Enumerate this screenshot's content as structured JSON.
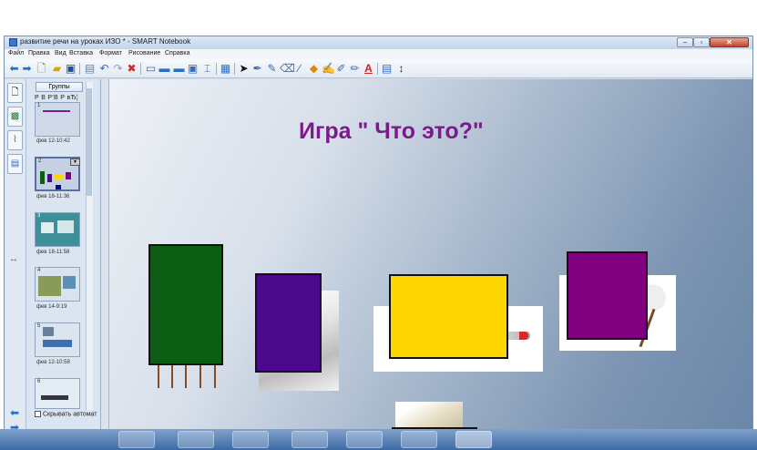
{
  "window": {
    "title": "развитие речи на уроках ИЗО * - SMART Notebook",
    "minimize_glyph": "–",
    "maximize_glyph": "▫",
    "close_glyph": "✕"
  },
  "menu": [
    "Файл",
    "Правка",
    "Вид",
    "Вставка",
    "Формат",
    "Рисование",
    "Справка"
  ],
  "toolbar_icons": [
    "back-arrow-icon",
    "forward-arrow-icon",
    "blank-page-icon",
    "open-folder-icon",
    "save-icon",
    "paste-icon",
    "undo-icon",
    "redo-icon",
    "delete-icon",
    "screen-shade-icon",
    "full-screen-icon",
    "dual-display-icon",
    "capture-icon",
    "document-camera-icon",
    "table-icon",
    "select-icon",
    "pen-icon",
    "creative-pen-icon",
    "eraser-icon",
    "line-icon",
    "shape-icon",
    "fill-icon",
    "magic-pen-icon",
    "shape-recognition-pen-icon",
    "text-icon",
    "properties-icon",
    "more-icon"
  ],
  "sorter": {
    "groups_button": "Группы",
    "group_tag": "Р В Р'В Р вЂ¦",
    "thumbnails": [
      {
        "num": "1",
        "date": "фев 12-10:42"
      },
      {
        "num": "2",
        "date": "фев 18-11:36"
      },
      {
        "num": "3",
        "date": "фев 18-11:58"
      },
      {
        "num": "4",
        "date": "фев 14-9:19"
      },
      {
        "num": "5",
        "date": "фев 12-10:58"
      },
      {
        "num": "6",
        "date": ""
      }
    ],
    "autohide_label": "Скрывать автомат"
  },
  "slide": {
    "title": "Игра \" Что это?\"",
    "colors": {
      "title": "#7c1a8c",
      "green": "#0b5e13",
      "indigo": "#4b0a8c",
      "yellow": "#ffd700",
      "purple": "#800080",
      "navy": "#0a0a8a"
    }
  }
}
